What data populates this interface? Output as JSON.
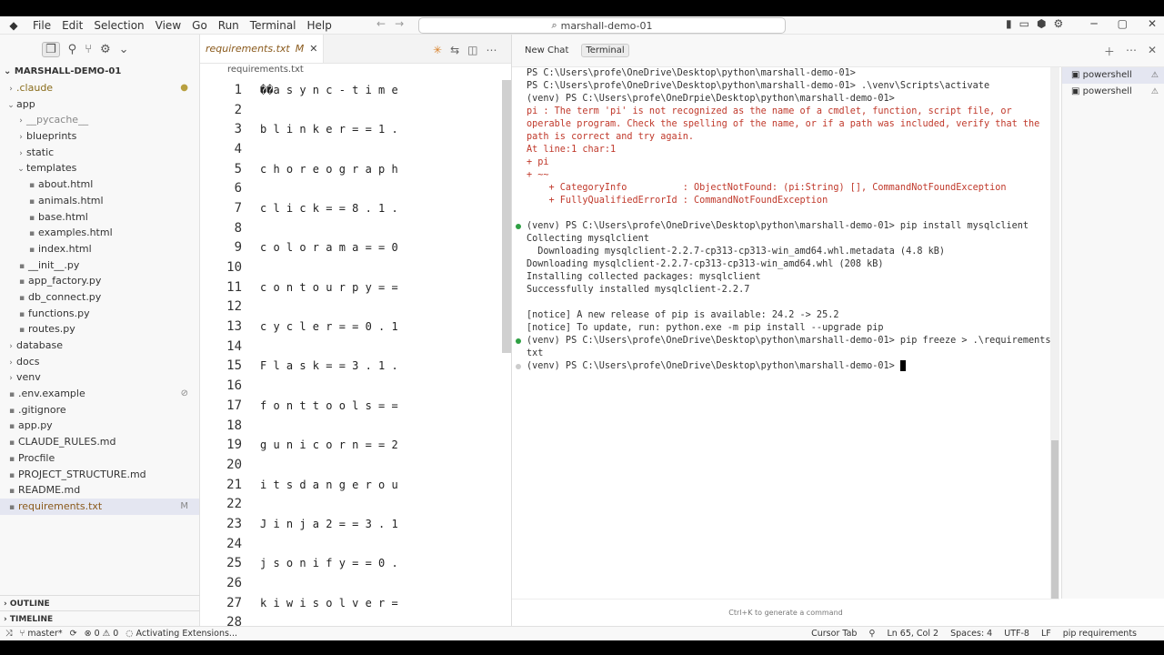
{
  "titlebar": {
    "menu": [
      "File",
      "Edit",
      "Selection",
      "View",
      "Go",
      "Run",
      "Terminal",
      "Help"
    ],
    "search": "marshall-demo-01"
  },
  "sidebar": {
    "project": "MARSHALL-DEMO-01",
    "tree": [
      {
        "label": ".claude",
        "type": "folder",
        "open": false,
        "depth": 0,
        "dot": true
      },
      {
        "label": "app",
        "type": "folder",
        "open": true,
        "depth": 0
      },
      {
        "label": "__pycache__",
        "type": "folder",
        "open": false,
        "depth": 1,
        "muted": true
      },
      {
        "label": "blueprints",
        "type": "folder",
        "open": false,
        "depth": 1
      },
      {
        "label": "static",
        "type": "folder",
        "open": false,
        "depth": 1
      },
      {
        "label": "templates",
        "type": "folder",
        "open": true,
        "depth": 1
      },
      {
        "label": "about.html",
        "type": "file",
        "depth": 2
      },
      {
        "label": "animals.html",
        "type": "file",
        "depth": 2
      },
      {
        "label": "base.html",
        "type": "file",
        "depth": 2
      },
      {
        "label": "examples.html",
        "type": "file",
        "depth": 2
      },
      {
        "label": "index.html",
        "type": "file",
        "depth": 2
      },
      {
        "label": "__init__.py",
        "type": "file",
        "depth": 1
      },
      {
        "label": "app_factory.py",
        "type": "file",
        "depth": 1
      },
      {
        "label": "db_connect.py",
        "type": "file",
        "depth": 1
      },
      {
        "label": "functions.py",
        "type": "file",
        "depth": 1
      },
      {
        "label": "routes.py",
        "type": "file",
        "depth": 1
      },
      {
        "label": "database",
        "type": "folder",
        "open": false,
        "depth": 0
      },
      {
        "label": "docs",
        "type": "folder",
        "open": false,
        "depth": 0
      },
      {
        "label": "venv",
        "type": "folder",
        "open": false,
        "depth": 0
      },
      {
        "label": ".env.example",
        "type": "file",
        "depth": 0,
        "badge": "⊘"
      },
      {
        "label": ".gitignore",
        "type": "file",
        "depth": 0
      },
      {
        "label": "app.py",
        "type": "file",
        "depth": 0
      },
      {
        "label": "CLAUDE_RULES.md",
        "type": "file",
        "depth": 0
      },
      {
        "label": "Procfile",
        "type": "file",
        "depth": 0
      },
      {
        "label": "PROJECT_STRUCTURE.md",
        "type": "file",
        "depth": 0
      },
      {
        "label": "README.md",
        "type": "file",
        "depth": 0
      },
      {
        "label": "requirements.txt",
        "type": "file",
        "depth": 0,
        "selected": true,
        "badge": "M"
      }
    ],
    "outline": "OUTLINE",
    "timeline": "TIMELINE"
  },
  "editor": {
    "tab": "requirements.txt",
    "tab_badge": "M",
    "breadcrumb": "requirements.txt",
    "lines": [
      {
        "n": "1",
        "t": "��a s y n c - t i m e"
      },
      {
        "n": "2",
        "t": ""
      },
      {
        "n": "3",
        "t": "b l i n k e r = = 1 ."
      },
      {
        "n": "4",
        "t": ""
      },
      {
        "n": "5",
        "t": "c h o r e o g r a p h"
      },
      {
        "n": "6",
        "t": ""
      },
      {
        "n": "7",
        "t": "c l i c k = = 8 . 1 ."
      },
      {
        "n": "8",
        "t": ""
      },
      {
        "n": "9",
        "t": "c o l o r a m a = = 0"
      },
      {
        "n": "10",
        "t": ""
      },
      {
        "n": "11",
        "t": "c o n t o u r p y = ="
      },
      {
        "n": "12",
        "t": ""
      },
      {
        "n": "13",
        "t": "c y c l e r = = 0 . 1"
      },
      {
        "n": "14",
        "t": ""
      },
      {
        "n": "15",
        "t": "F l a s k = = 3 . 1 ."
      },
      {
        "n": "16",
        "t": ""
      },
      {
        "n": "17",
        "t": "f o n t t o o l s = ="
      },
      {
        "n": "18",
        "t": ""
      },
      {
        "n": "19",
        "t": "g u n i c o r n = = 2"
      },
      {
        "n": "20",
        "t": ""
      },
      {
        "n": "21",
        "t": "i t s d a n g e r o u"
      },
      {
        "n": "22",
        "t": ""
      },
      {
        "n": "23",
        "t": "J i n j a 2 = = 3 . 1"
      },
      {
        "n": "24",
        "t": ""
      },
      {
        "n": "25",
        "t": "j s o n i f y = = 0 ."
      },
      {
        "n": "26",
        "t": ""
      },
      {
        "n": "27",
        "t": "k i w i s o l v e r ="
      },
      {
        "n": "28",
        "t": ""
      }
    ]
  },
  "chat": {
    "tabs": [
      "New Chat",
      "Terminal"
    ]
  },
  "terminal": {
    "lines": [
      {
        "t": "PS C:\\Users\\profe\\OneDrive\\Desktop\\python\\marshall-demo-01>",
        "c": ""
      },
      {
        "t": "PS C:\\Users\\profe\\OneDrive\\Desktop\\python\\marshall-demo-01> .\\venv\\Scripts\\activate",
        "c": ""
      },
      {
        "t": "(venv) PS C:\\Users\\profe\\OneDrpie\\Desktop\\python\\marshall-demo-01>",
        "c": ""
      },
      {
        "t": "pi : The term 'pi' is not recognized as the name of a cmdlet, function, script file, or",
        "c": "err"
      },
      {
        "t": "operable program. Check the spelling of the name, or if a path was included, verify that the",
        "c": "err"
      },
      {
        "t": "path is correct and try again.",
        "c": "err"
      },
      {
        "t": "At line:1 char:1",
        "c": "err"
      },
      {
        "t": "+ pi",
        "c": "err"
      },
      {
        "t": "+ ~~",
        "c": "err"
      },
      {
        "t": "    + CategoryInfo          : ObjectNotFound: (pi:String) [], CommandNotFoundException",
        "c": "err"
      },
      {
        "t": "    + FullyQualifiedErrorId : CommandNotFoundException",
        "c": "err"
      },
      {
        "t": "",
        "c": ""
      },
      {
        "t": "(venv) PS C:\\Users\\profe\\OneDrive\\Desktop\\python\\marshall-demo-01> pip install mysqlclient",
        "c": "",
        "dot": "#2ea043"
      },
      {
        "t": "Collecting mysqlclient",
        "c": ""
      },
      {
        "t": "  Downloading mysqlclient-2.2.7-cp313-cp313-win_amd64.whl.metadata (4.8 kB)",
        "c": ""
      },
      {
        "t": "Downloading mysqlclient-2.2.7-cp313-cp313-win_amd64.whl (208 kB)",
        "c": ""
      },
      {
        "t": "Installing collected packages: mysqlclient",
        "c": ""
      },
      {
        "t": "Successfully installed mysqlclient-2.2.7",
        "c": ""
      },
      {
        "t": "",
        "c": ""
      },
      {
        "t": "[notice] A new release of pip is available: 24.2 -> 25.2",
        "c": ""
      },
      {
        "t": "[notice] To update, run: python.exe -m pip install --upgrade pip",
        "c": ""
      },
      {
        "t": "(venv) PS C:\\Users\\profe\\OneDrive\\Desktop\\python\\marshall-demo-01> pip freeze > .\\requirements.",
        "c": "",
        "dot": "#2ea043"
      },
      {
        "t": "txt",
        "c": ""
      },
      {
        "t": "(venv) PS C:\\Users\\profe\\OneDrive\\Desktop\\python\\marshall-demo-01> ",
        "c": "",
        "dot": "#cccccc",
        "cursor": true
      }
    ],
    "shells": [
      "powershell",
      "powershell"
    ],
    "hint": "Ctrl+K to generate a command"
  },
  "statusbar": {
    "branch": "master*",
    "problems": "0",
    "warnings": "0",
    "activity": "Activating Extensions...",
    "cursor_tab": "Cursor Tab",
    "position": "Ln 65, Col 2",
    "spaces": "Spaces: 4",
    "encoding": "UTF-8",
    "eol": "LF",
    "language": "pip requirements"
  }
}
